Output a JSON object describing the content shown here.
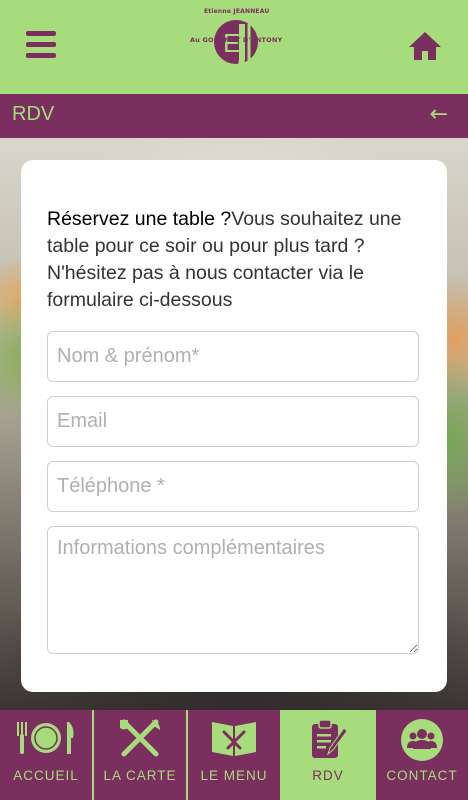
{
  "header": {
    "logo_initials": "EJ",
    "logo_name": "Etienne JEANNEAU",
    "logo_subtitle": "Au GOURMET D'ANTONY",
    "menu_icon": "hamburger-icon",
    "home_icon": "home-icon"
  },
  "titlebar": {
    "title": "RDV",
    "back_arrow": "←"
  },
  "form": {
    "intro_lead": "Réservez une table ?",
    "intro_rest": "Vous souhaitez une table pour ce soir ou pour plus tard ?N'hésitez pas à nous contacter via le formulaire ci-dessous",
    "name_placeholder": "Nom & prénom*",
    "email_placeholder": "Email",
    "phone_placeholder": "Téléphone *",
    "info_placeholder": "Informations complémentaires"
  },
  "navbar": {
    "items": [
      {
        "label": "ACCUEIL",
        "icon": "plate-icon"
      },
      {
        "label": "LA CARTE",
        "icon": "utensils-icon"
      },
      {
        "label": "LE MENU",
        "icon": "menu-book-icon"
      },
      {
        "label": "RDV",
        "icon": "clipboard-icon",
        "active": true
      },
      {
        "label": "CONTACT",
        "icon": "group-icon"
      }
    ]
  },
  "colors": {
    "green": "#a6dc7c",
    "plum": "#7b2f5f"
  }
}
